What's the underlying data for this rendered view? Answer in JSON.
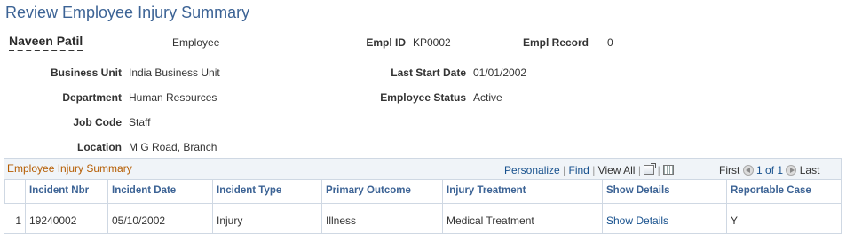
{
  "page": {
    "title": "Review Employee Injury Summary"
  },
  "employee": {
    "name": "Naveen Patil",
    "role": "Employee",
    "empl_id_label": "Empl ID",
    "empl_id": "KP0002",
    "empl_record_label": "Empl Record",
    "empl_record": "0",
    "business_unit_label": "Business Unit",
    "business_unit": "India Business Unit",
    "last_start_date_label": "Last Start Date",
    "last_start_date": "01/01/2002",
    "department_label": "Department",
    "department": "Human Resources",
    "employee_status_label": "Employee Status",
    "employee_status": "Active",
    "job_code_label": "Job Code",
    "job_code": "Staff",
    "location_label": "Location",
    "location": "M G Road, Branch"
  },
  "grid": {
    "title": "Employee Injury Summary",
    "personalize": "Personalize",
    "sep": "|",
    "find": "Find",
    "view_all": "View All",
    "first": "First",
    "range": "1 of 1",
    "last": "Last",
    "columns": {
      "incident_nbr": "Incident Nbr",
      "incident_date": "Incident Date",
      "incident_type": "Incident Type",
      "primary_outcome": "Primary Outcome",
      "injury_treatment": "Injury Treatment",
      "show_details": "Show Details",
      "reportable_case": "Reportable Case"
    },
    "rows": [
      {
        "num": "1",
        "incident_nbr": "19240002",
        "incident_date": "05/10/2002",
        "incident_type": "Injury",
        "primary_outcome": "Illness",
        "injury_treatment": "Medical Treatment",
        "show_details": "Show Details",
        "reportable_case": "Y"
      }
    ]
  },
  "icons": {
    "zoom": "zoom-grid-icon",
    "download": "download-to-excel-icon",
    "prev": "previous-row-icon",
    "next": "next-row-icon"
  },
  "colors": {
    "title": "#3c6395",
    "grid_title": "#b55c00",
    "link": "#16508d",
    "border": "#cfd8e3",
    "header_bg": "#f0f4f8"
  }
}
